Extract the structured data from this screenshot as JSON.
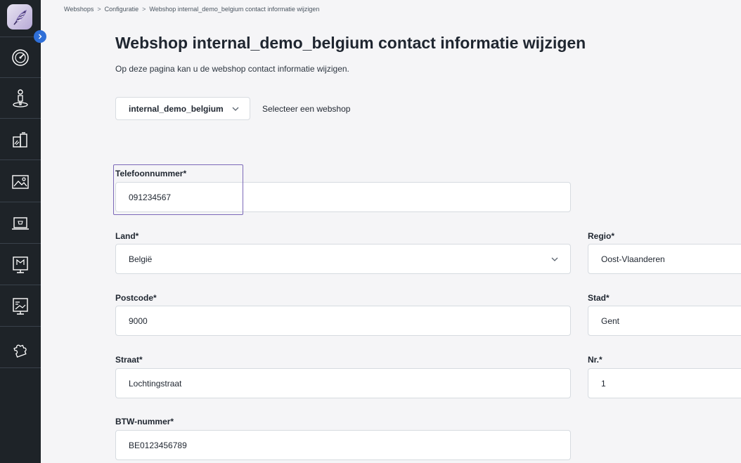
{
  "breadcrumb": {
    "items": [
      "Webshops",
      "Configuratie",
      "Webshop internal_demo_belgium contact informatie wijzigen"
    ],
    "separator": ">"
  },
  "page": {
    "title": "Webshop internal_demo_belgium contact informatie wijzigen",
    "subtitle": "Op deze pagina kan u de webshop contact informatie wijzigen."
  },
  "webshop_select": {
    "value": "internal_demo_belgium",
    "label": "Selecteer een webshop"
  },
  "form": {
    "phone": {
      "label": "Telefoonnummer*",
      "value": "091234567"
    },
    "country": {
      "label": "Land*",
      "value": "België"
    },
    "region": {
      "label": "Regio*",
      "value": "Oost-Vlaanderen"
    },
    "postcode": {
      "label": "Postcode*",
      "value": "9000"
    },
    "city": {
      "label": "Stad*",
      "value": "Gent"
    },
    "street": {
      "label": "Straat*",
      "value": "Lochtingstraat"
    },
    "number": {
      "label": "Nr.*",
      "value": "1"
    },
    "vat": {
      "label": "BTW-nummer*",
      "value": "BE0123456789"
    }
  },
  "sidebar": {
    "icons": [
      "dashboard-icon",
      "user-icon",
      "products-icon",
      "image-icon",
      "webshop-icon",
      "marketing-icon",
      "presentation-icon",
      "puzzle-icon"
    ]
  },
  "colors": {
    "sidebar_bg": "#1e2328",
    "accent_blue": "#2f6fd8",
    "highlight": "#7b68b8",
    "page_bg": "#f5f5f7"
  }
}
